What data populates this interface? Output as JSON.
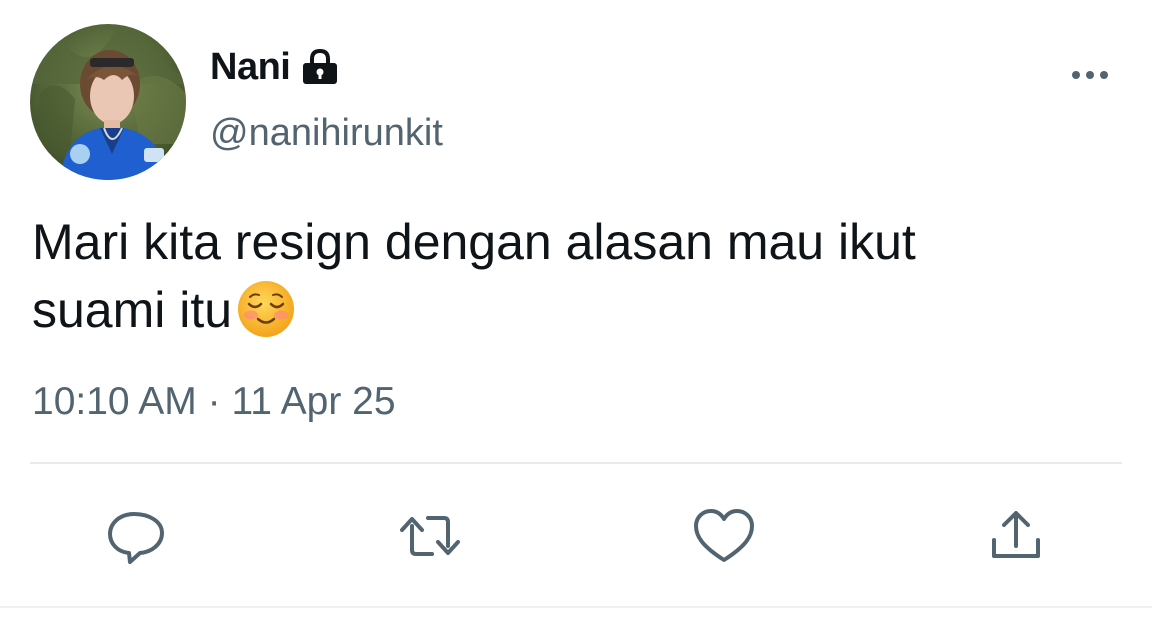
{
  "tweet": {
    "author": {
      "display_name": "Nani",
      "handle": "@nanihirunkit",
      "protected_icon": "lock-icon"
    },
    "text_lines": [
      "Mari kita resign dengan alasan mau ikut",
      "suami itu"
    ],
    "emoji": "smiling-face-icon",
    "time": "10:10 AM",
    "separator": "·",
    "date": "11 Apr 25"
  },
  "actions": {
    "reply_icon": "comment-icon",
    "retweet_icon": "retweet-icon",
    "like_icon": "heart-icon",
    "share_icon": "share-icon",
    "more_icon": "more-horizontal-icon"
  },
  "colors": {
    "text_primary": "#0f1419",
    "text_secondary": "#536471",
    "icon_gray": "#536471",
    "divider": "#e6ecf0"
  }
}
